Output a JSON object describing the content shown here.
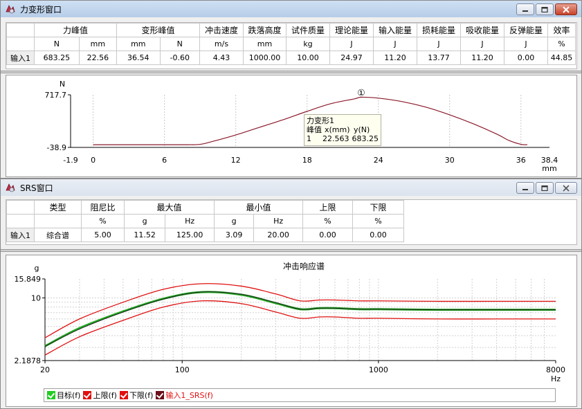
{
  "force_window": {
    "title": "力变形窗口",
    "table": {
      "group_headers": [
        "力峰值",
        "变形峰值",
        "冲击速度",
        "跌落高度",
        "试件质量",
        "理论能量",
        "输入能量",
        "损耗能量",
        "吸收能量",
        "反弹能量",
        "效率"
      ],
      "units": [
        "N",
        "mm",
        "mm",
        "N",
        "m/s",
        "mm",
        "kg",
        "J",
        "J",
        "J",
        "J",
        "J",
        "%"
      ],
      "row_label": "输入1",
      "values": [
        "683.25",
        "22.56",
        "36.54",
        "-0.60",
        "4.43",
        "1000.00",
        "10.00",
        "24.97",
        "11.20",
        "13.77",
        "11.20",
        "0.00",
        "44.85"
      ]
    },
    "chart": {
      "y_unit": "N",
      "x_unit": "mm",
      "marker": "①",
      "tooltip": {
        "title": "力变形1",
        "h1": "峰值",
        "h2": "x(mm)",
        "h3": "y(N)",
        "idx": "1",
        "x": "22.563",
        "y": "683.25"
      }
    }
  },
  "srs_window": {
    "title": "SRS窗口",
    "table": {
      "headers": [
        "类型",
        "阻尼比",
        "最大值",
        "最小值",
        "上限",
        "下限"
      ],
      "units": [
        "%",
        "g",
        "Hz",
        "g",
        "Hz",
        "%",
        "%"
      ],
      "row_label": "输入1",
      "values": [
        "综合谱",
        "5.00",
        "11.52",
        "125.00",
        "3.09",
        "20.00",
        "0.00",
        "0.00"
      ]
    },
    "legend": [
      "目标(f)",
      "上限(f)",
      "下限(f)",
      "输入1_SRS(f)"
    ]
  },
  "colors": {
    "curve1": "#8b1a2a",
    "target": "#22aa22",
    "limit": "#e01010",
    "srs": "#202020"
  },
  "chart_data": [
    {
      "type": "line",
      "title": "",
      "xlabel": "mm",
      "ylabel": "N",
      "xlim": [
        -1.9,
        38.4
      ],
      "ylim": [
        -38.9,
        717.7
      ],
      "x_ticks": [
        "-1.9",
        "0",
        "6",
        "12",
        "18",
        "24",
        "30",
        "36",
        "38.4"
      ],
      "y_ticks": [
        "717.7",
        "-38.9"
      ],
      "series": [
        {
          "name": "力变形1",
          "x": [
            0,
            6,
            8,
            9,
            10,
            12,
            14,
            16,
            18,
            20,
            22,
            22.56,
            24,
            26,
            28,
            30,
            32,
            34,
            35,
            36,
            36.54
          ],
          "y": [
            0,
            0,
            0,
            5,
            45,
            140,
            250,
            360,
            480,
            590,
            660,
            683,
            670,
            620,
            540,
            430,
            300,
            150,
            60,
            5,
            0
          ]
        }
      ]
    },
    {
      "type": "line",
      "title": "冲击响应谱",
      "xlabel": "Hz",
      "ylabel": "g",
      "x_scale": "log",
      "y_scale": "log",
      "xlim": [
        20,
        8000
      ],
      "ylim": [
        2.1878,
        15.849
      ],
      "x_ticks": [
        "20",
        "100",
        "1000",
        "8000"
      ],
      "y_ticks": [
        "15.849",
        "10",
        "2.1878"
      ],
      "x": [
        20,
        30,
        50,
        80,
        125,
        200,
        300,
        400,
        500,
        600,
        800,
        1000,
        2000,
        4000,
        8000
      ],
      "series": [
        {
          "name": "目标(f)",
          "values": [
            3.1,
            4.8,
            7.2,
            9.8,
            11.5,
            10.8,
            8.8,
            7.6,
            7.8,
            7.8,
            7.6,
            7.6,
            7.5,
            7.5,
            7.5
          ]
        },
        {
          "name": "上限(f)",
          "values": [
            3.8,
            6.0,
            9.0,
            12.3,
            14.1,
            13.3,
            11.0,
            9.3,
            9.5,
            9.5,
            9.3,
            9.3,
            9.2,
            9.2,
            9.2
          ]
        },
        {
          "name": "下限(f)",
          "values": [
            2.5,
            3.9,
            5.8,
            8.0,
            9.3,
            8.7,
            7.1,
            6.1,
            6.3,
            6.3,
            6.1,
            6.1,
            6.0,
            6.0,
            6.0
          ]
        },
        {
          "name": "输入1_SRS(f)",
          "values": [
            3.09,
            4.7,
            7.1,
            9.7,
            11.52,
            10.9,
            8.9,
            7.6,
            7.8,
            7.8,
            7.6,
            7.6,
            7.5,
            7.5,
            7.5
          ]
        }
      ]
    }
  ]
}
